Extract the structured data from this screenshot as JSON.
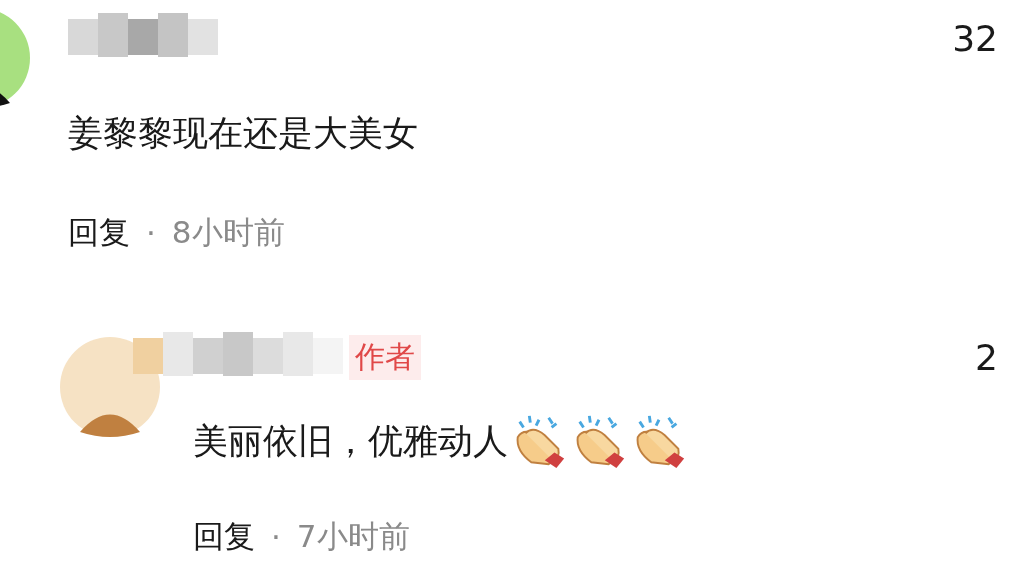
{
  "comments": [
    {
      "avatar": {
        "color": "#a8e080"
      },
      "likes": "32",
      "text": "姜黎黎现在还是大美女",
      "reply": "回复",
      "separator": "·",
      "time": "8小时前"
    },
    {
      "avatar": {
        "color": "#f6e2c4"
      },
      "badge": "作者",
      "likes": "2",
      "text": "美丽依旧，优雅动人",
      "reactions": [
        {
          "kind": "clap"
        },
        {
          "kind": "clap"
        },
        {
          "kind": "clap"
        }
      ],
      "reply": "回复",
      "separator": "·",
      "time": "7小时前"
    }
  ]
}
